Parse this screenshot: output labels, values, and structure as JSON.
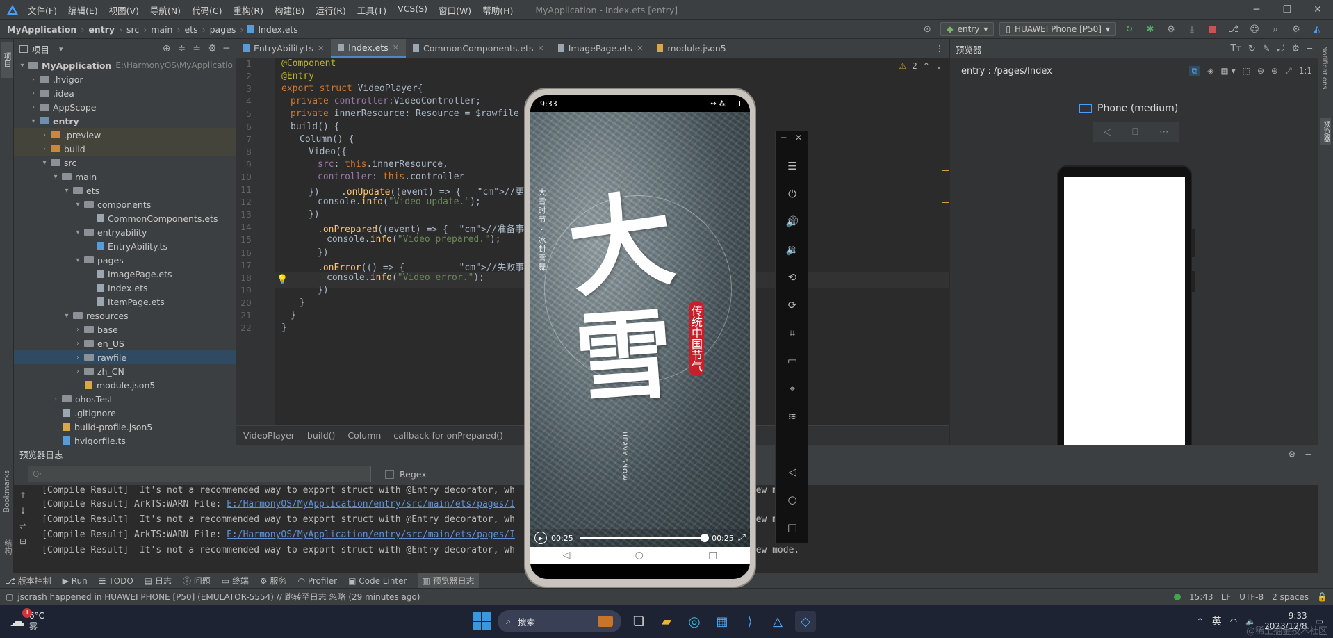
{
  "titlebar": {
    "menus": [
      "文件(F)",
      "编辑(E)",
      "视图(V)",
      "导航(N)",
      "代码(C)",
      "重构(R)",
      "构建(B)",
      "运行(R)",
      "工具(T)",
      "VCS(S)",
      "窗口(W)",
      "帮助(H)"
    ],
    "title": "MyApplication - Index.ets [entry]"
  },
  "breadcrumb": [
    "MyApplication",
    "entry",
    "src",
    "main",
    "ets",
    "pages",
    "Index.ets"
  ],
  "toolbar": {
    "module": "entry",
    "device": "HUAWEI Phone [P50]"
  },
  "project": {
    "header": "项目",
    "root": "MyApplication",
    "root_path": "E:\\HarmonyOS\\MyApplicatio",
    "items": [
      ".hvigor",
      ".idea",
      "AppScope",
      "entry",
      ".preview",
      "build",
      "src",
      "main",
      "ets",
      "components",
      "CommonComponents.ets",
      "entryability",
      "EntryAbility.ts",
      "pages",
      "ImagePage.ets",
      "Index.ets",
      "ItemPage.ets",
      "resources",
      "base",
      "en_US",
      "rawfile",
      "zh_CN",
      "module.json5",
      "ohosTest",
      ".gitignore",
      "build-profile.json5",
      "hvigorfile.ts"
    ]
  },
  "tabs": [
    "EntryAbility.ts",
    "Index.ets",
    "CommonComponents.ets",
    "ImagePage.ets",
    "module.json5"
  ],
  "editor": {
    "warnings": "2",
    "lines": [
      "@Component",
      "@Entry",
      "export struct VideoPlayer{",
      "private controller:VideoController;",
      "private innerResource: Resource = $rawfile",
      "build() {",
      "Column() {",
      "Video({",
      "src: this.innerResource,",
      "controller: this.controller",
      "})    .onUpdate((event) => {   //更新事件",
      "console.info(\"Video update.\");",
      "})",
      ".onPrepared((event) => {  //准备事件回",
      "console.info(\"Video prepared.\");",
      "})",
      ".onError(() => {          //失败事件回",
      "console.info(\"Video error.\");",
      "})",
      "}",
      "}",
      "}"
    ],
    "crumbs": [
      "VideoPlayer",
      "build()",
      "Column",
      "callback for onPrepared()"
    ]
  },
  "previewer": {
    "title": "预览器",
    "path": "entry : /pages/Index",
    "device_label": "Phone (medium)",
    "notifications_label": "Notifications",
    "side_label": "预览器"
  },
  "phone": {
    "time": "9:33",
    "poster_title_1": "大",
    "poster_title_2": "雪",
    "poster_badge": "传统中国节气",
    "poster_side_text": "大雪时节 · 冰封雪舞",
    "poster_en": "HEAVY SNOW",
    "player": {
      "current": "00:25",
      "duration": "00:25",
      "progress": 1.0
    }
  },
  "log": {
    "title": "预览器日志",
    "search_placeholder": "Q·",
    "regex": "Regex",
    "lines": [
      {
        "text": "[Compile Result]  It's not a recommended way to export struct with @Entry decorator, wh",
        "tail": "nt preview mode.",
        "link": ""
      },
      {
        "text": "[Compile Result] ArkTS:WARN File: ",
        "link": "E:/HarmonyOS/MyApplication/entry/src/main/ets/pages/I",
        "tail": ""
      },
      {
        "text": "[Compile Result]  It's not a recommended way to export struct with @Entry decorator, wh",
        "tail": "nt preview mode.",
        "link": ""
      },
      {
        "text": "[Compile Result] ArkTS:WARN File: ",
        "link": "E:/HarmonyOS/MyApplication/entry/src/main/ets/pages/I",
        "tail": ""
      },
      {
        "text": "[Compile Result]  It's not a recommended way to export struct with @Entry decorator, wh",
        "tail": "nt preview mode.",
        "link": ""
      }
    ]
  },
  "bottom_tools": [
    "版本控制",
    "Run",
    "TODO",
    "日志",
    "问题",
    "终端",
    "服务",
    "Profiler",
    "Code Linter",
    "预览器日志"
  ],
  "status": {
    "message": "jscrash happened in HUAWEI PHONE [P50] (EMULATOR-5554) // 跳转至日志   忽略 (29 minutes ago)",
    "pos": "15:43",
    "eol": "LF",
    "enc": "UTF-8",
    "indent": "2 spaces"
  },
  "taskbar": {
    "temp": "6°C",
    "weather": "雾",
    "badge": "1",
    "search": "搜索",
    "ime": "英",
    "time": "9:33",
    "date": "2023/12/8",
    "watermark": "@稀土掘金技术社区"
  },
  "left_strip": [
    "项目",
    "Bookmarks",
    "结构"
  ],
  "colors": {
    "accent": "#4a88c7",
    "bg": "#2b2b2b",
    "panel": "#3c3f41",
    "keyword": "#cc7832",
    "string": "#6a8759",
    "annotation": "#bbb529"
  }
}
